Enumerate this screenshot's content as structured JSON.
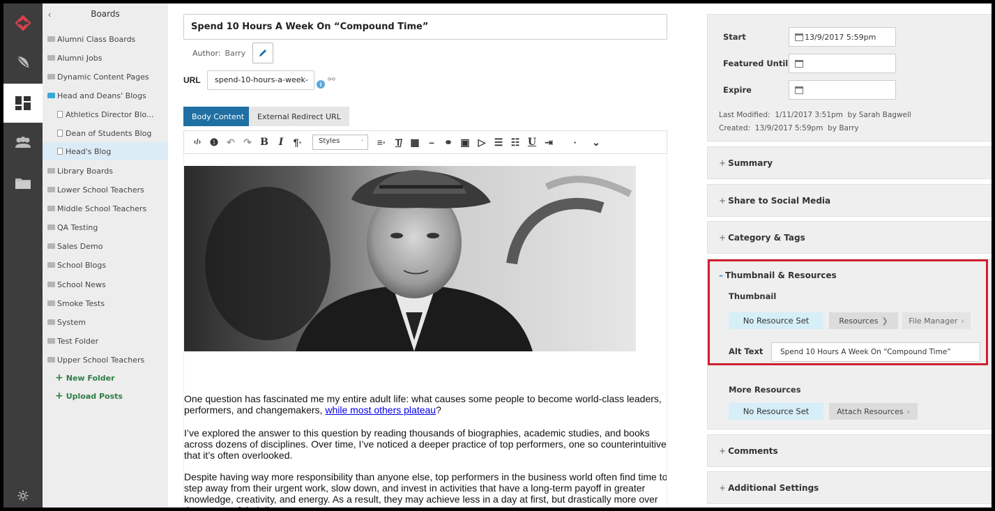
{
  "rail": {
    "icons": [
      "logo-icon",
      "feather-icon",
      "dashboard-icon",
      "people-icon",
      "folder-icon",
      "settings-icon"
    ]
  },
  "tree": {
    "back_glyph": "‹",
    "title": "Boards",
    "items": [
      {
        "label": "Alumni Class Boards"
      },
      {
        "label": "Alumni Jobs"
      },
      {
        "label": "Dynamic Content Pages"
      },
      {
        "label": "Head and Deans' Blogs"
      },
      {
        "label": "Athletics Director Blo..."
      },
      {
        "label": "Dean of Students Blog"
      },
      {
        "label": "Head's Blog"
      },
      {
        "label": "Library Boards"
      },
      {
        "label": "Lower School Teachers"
      },
      {
        "label": "Middle School Teachers"
      },
      {
        "label": "QA Testing"
      },
      {
        "label": "Sales Demo"
      },
      {
        "label": "School Blogs"
      },
      {
        "label": "School News"
      },
      {
        "label": "Smoke Tests"
      },
      {
        "label": "System"
      },
      {
        "label": "Test Folder"
      },
      {
        "label": "Upper School Teachers"
      }
    ],
    "new_folder": "New Folder",
    "upload_posts": "Upload Posts"
  },
  "editor": {
    "title": "Spend 10 Hours A Week On “Compound Time”",
    "author_label": "Author:",
    "author_value": "Barry",
    "url_label": "URL",
    "url_value": "spend-10-hours-a-week-",
    "tabs": [
      "Body Content",
      "External Redirect URL"
    ],
    "styles_label": "Styles",
    "paragraphs": {
      "p1a": "One question has fascinated me my entire adult life: what causes some people to become world-class leaders, performers, and changemakers, ",
      "p1link": "while most others plateau",
      "p1b": "?",
      "p2": "I’ve explored the answer to this question by reading thousands of biographies, academic studies, and books across dozens of disciplines. Over time, I’ve noticed a deeper practice of top performers, one so counterintuitive that it’s often overlooked.",
      "p3": "Despite having way more responsibility than anyone else, top performers in the business world often find time to step away from their urgent work, slow down, and invest in activities that have a long-term payoff in greater knowledge, creativity, and energy. As a result, they may achieve less in a day at first, but drastically more over the course of their lives."
    }
  },
  "publish": {
    "start_label": "Start",
    "start_value": "13/9/2017 5:59pm",
    "featured_label": "Featured Until",
    "expire_label": "Expire",
    "last_modified_label": "Last Modified:",
    "last_modified_value": "1/11/2017 3:51pm",
    "last_modified_by": "by Sarah Bagwell",
    "created_label": "Created:",
    "created_value": "13/9/2017 5:59pm",
    "created_by": "by Barry"
  },
  "sections": {
    "summary": "Summary",
    "share": "Share to Social Media",
    "category": "Category & Tags",
    "thumbnail": "Thumbnail & Resources",
    "comments": "Comments",
    "additional": "Additional Settings"
  },
  "thumbnail": {
    "label": "Thumbnail",
    "no_resource": "No Resource Set",
    "resources_btn": "Resources",
    "file_manager_btn": "File Manager",
    "alt_label": "Alt Text",
    "alt_value": "Spend 10 Hours A Week On “Compound Time”",
    "more_label": "More Resources",
    "more_no_resource": "No Resource Set",
    "attach_btn": "Attach Resources"
  },
  "colors": {
    "accent": "#1f6fa3",
    "highlight": "#d0202f",
    "logo": "#e0404c",
    "link_green": "#2e7d46"
  }
}
